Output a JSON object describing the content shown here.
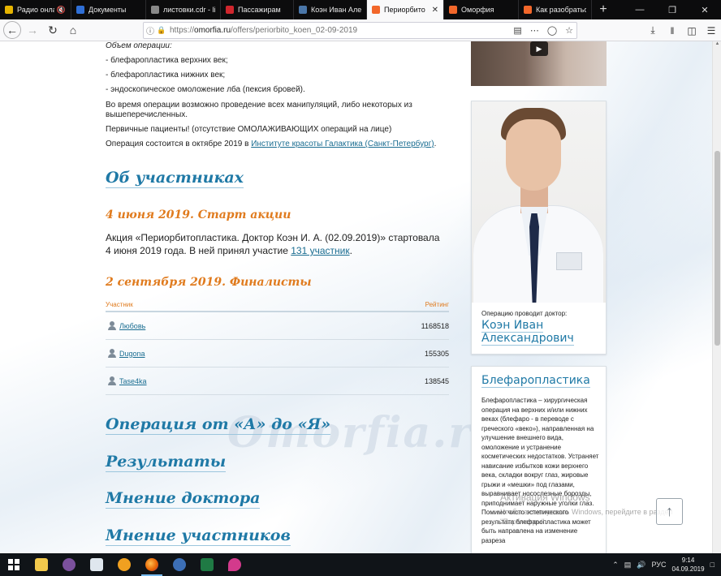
{
  "browser": {
    "tabs": [
      {
        "label": "Радио онлайн",
        "icon": "radio-icon",
        "color": "#e6b400",
        "muted": true
      },
      {
        "label": "Документы",
        "icon": "docs-icon",
        "color": "#2f6fd6"
      },
      {
        "label": "листовки.cdr - listovki",
        "icon": "file-icon",
        "color": "#888888"
      },
      {
        "label": "Пассажирам",
        "icon": "sale-icon",
        "color": "#d0262d"
      },
      {
        "label": "Коэн Иван Алексан",
        "icon": "vk-icon",
        "color": "#4a76a8"
      },
      {
        "label": "Периорбито",
        "icon": "omorfia-icon",
        "color": "#f2672a",
        "active": true
      },
      {
        "label": "Оморфия",
        "icon": "omorfia-icon",
        "color": "#f2672a"
      },
      {
        "label": "Как разобраться",
        "icon": "omorfia-icon",
        "color": "#f2672a"
      }
    ],
    "url_prefix": "https://",
    "url_domain": "omorfia.ru",
    "url_path": "/offers/periorbito_koen_02-09-2019"
  },
  "page": {
    "lines": [
      "Объем операции:",
      "- блефаропластика верхних век;",
      "- блефаропластика нижних век;",
      "- эндоскопическое омоложение лба (пексия бровей)."
    ],
    "line5a": "Во время операции возможно проведение всех манипуляций, либо некоторых из",
    "line5b": "вышеперечисленных.",
    "line6": "Первичные пациенты! (отсутствие ОМОЛАЖИВАЮЩИХ операций на лице)",
    "line7_pre": "Операция состоится в октябре 2019 в ",
    "line7_link": "Институте красоты Галактика (Санкт-Петербург)",
    "line7_post": ".",
    "h_participants": "Об участниках",
    "h_start": "4 июня 2019. Старт акции",
    "announce_pre": "Акция «Периорбитопластика. Доктор Коэн И. А. (02.09.2019)» стартовала 4 июня 2019 года. В ней принял участие ",
    "announce_link": "131 участник",
    "announce_post": ".",
    "h_finalists": "2 сентября 2019. Финалисты",
    "table": {
      "col_participant": "Участник",
      "col_rating": "Рейтинг",
      "rows": [
        {
          "name": "Любовь",
          "rating": "1168518"
        },
        {
          "name": "Dugona",
          "rating": "155305"
        },
        {
          "name": "Tase4ka",
          "rating": "138545"
        }
      ]
    },
    "h_operation": "Операция от «А» до «Я»",
    "h_results": "Результаты",
    "h_doctor_opinion": "Мнение доктора",
    "h_participants_opinion": "Мнение участников",
    "watermark": "Omorfia.ru"
  },
  "sidebar": {
    "doctor_label": "Операцию проводит доктор:",
    "doctor_name_1": "Коэн Иван",
    "doctor_name_2": "Александрович",
    "card_title": "Блефаропластика",
    "card_text": "Блефаропластика – хирургическая операция на верхних и/или нижних веках (блефаро - в переводе с греческого «веко»), направленная на улучшение внешнего вида, омоложение и устранение косметических недостатков. Устраняет нависание избытков кожи верхнего века, складки вокруг глаз, жировые грыжи и «мешки» под глазами, выравнивает носослезные борозды, приподнимает наружные уголки глаз. Помимо чисто эстетического результата блефаропластика может быть направлена на изменение разреза"
  },
  "windows_activation": {
    "line1": "Активация Windows",
    "line2": "Чтобы активировать Windows, перейдите в раздел \"Параметры\"."
  },
  "taskbar": {
    "lang": "РУС",
    "time": "9:14",
    "date": "04.09.2019"
  }
}
